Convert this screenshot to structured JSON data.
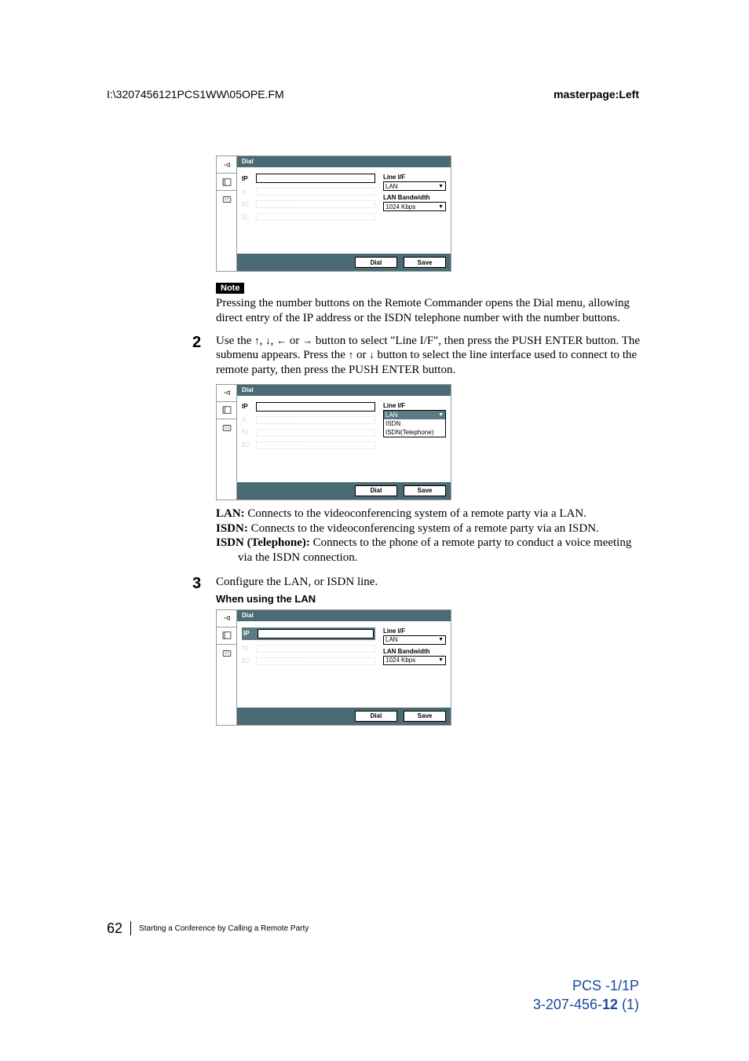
{
  "header": {
    "path": "I:\\3207456121PCS1WW\\05OPE.FM",
    "master": "masterpage:Left"
  },
  "dialogs": {
    "title": "Dial",
    "ip_label": "IP",
    "line_if_label": "Line I/F",
    "lan_value": "LAN",
    "bw_label": "LAN Bandwidth",
    "bw_value": "1024 Kbps",
    "dial_btn": "Dial",
    "save_btn": "Save",
    "dd_options": {
      "lan": "LAN",
      "isdn": "ISDN",
      "isdn_tel": "ISDN(Telephone)"
    }
  },
  "note": {
    "badge": "Note",
    "text": "Pressing the number buttons on the Remote Commander opens the Dial menu, allowing direct entry of the IP address or the ISDN telephone number with the number buttons."
  },
  "step2": {
    "num": "2",
    "text_a": "Use the ",
    "text_b": " button to select \"Line I/F\", then press the PUSH ENTER button. The submenu appears. Press the ",
    "text_c": " button to select the line interface used to connect to the remote party, then press the PUSH ENTER button."
  },
  "defs": {
    "lan_term": "LAN:",
    "lan_def": " Connects to the videoconferencing system of a remote party via a LAN.",
    "isdn_term": "ISDN:",
    "isdn_def": " Connects to the videoconferencing system of a remote party via an ISDN.",
    "tel_term": "ISDN (Telephone):",
    "tel_def": " Connects to the phone of a remote party to conduct a voice meeting via the ISDN connection."
  },
  "step3": {
    "num": "3",
    "text": "Configure the LAN, or ISDN line.",
    "sub": "When using the LAN"
  },
  "footer": {
    "pageno": "62",
    "text": "Starting a Conference by Calling a Remote Party"
  },
  "docid": {
    "line1": "PCS -1/1P",
    "line2_a": "3-207-456-",
    "line2_b": "12",
    "line2_c": " (1)"
  }
}
